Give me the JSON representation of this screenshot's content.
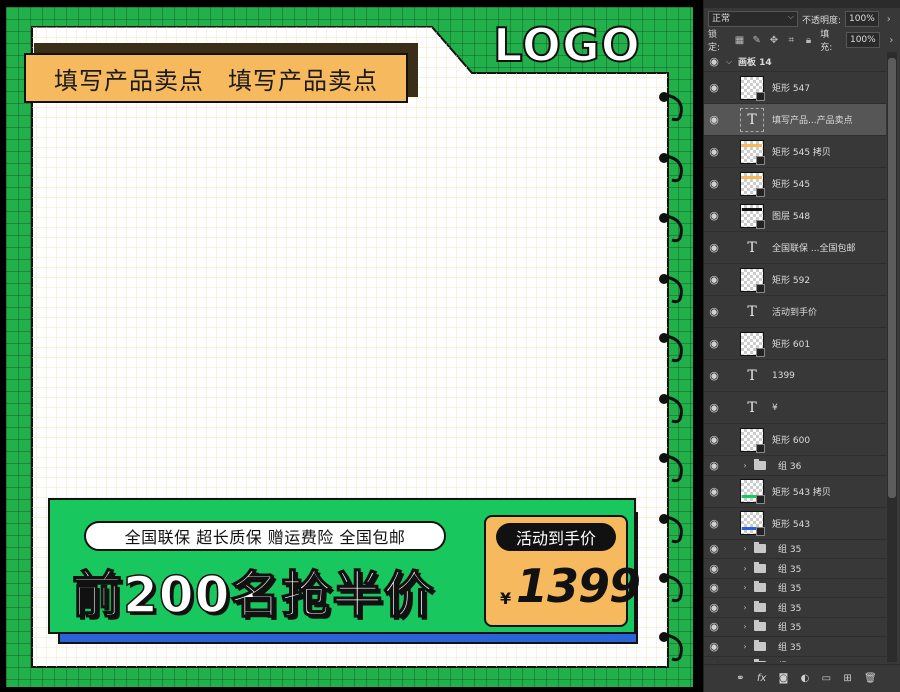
{
  "canvas": {
    "logo_text": "LOGO",
    "selling_points": [
      "填写产品卖点",
      "填写产品卖点"
    ],
    "guarantee_text": "全国联保 超长质保 赠运费险 全国包邮",
    "headline": "前200名抢半价",
    "activity_label": "活动到手价",
    "currency": "¥",
    "price": "1399"
  },
  "layers_panel": {
    "blend_mode": "正常",
    "opacity_label": "不透明度:",
    "opacity_value": "100%",
    "lock_label": "锁定:",
    "fill_label": "填充:",
    "fill_value": "100%",
    "artboard_name": "画板 14",
    "layers": [
      {
        "name": "矩形 547",
        "kind": "shape",
        "strip": ""
      },
      {
        "name": "填写产品...产品卖点",
        "kind": "text",
        "selected": true
      },
      {
        "name": "矩形 545 拷贝",
        "kind": "shape",
        "strip": "#f7b95e"
      },
      {
        "name": "矩形 545",
        "kind": "shape",
        "strip": "#f7b95e"
      },
      {
        "name": "图层 548",
        "kind": "shape",
        "strip": "#111111"
      },
      {
        "name": "全国联保 ...全国包邮",
        "kind": "text"
      },
      {
        "name": "矩形 592",
        "kind": "shape",
        "strip": ""
      },
      {
        "name": "活动到手价",
        "kind": "text"
      },
      {
        "name": "矩形 601",
        "kind": "shape",
        "strip": ""
      },
      {
        "name": "1399",
        "kind": "text"
      },
      {
        "name": "¥",
        "kind": "text"
      },
      {
        "name": "矩形 600",
        "kind": "shape",
        "strip": ""
      },
      {
        "name": "组 36",
        "kind": "group"
      },
      {
        "name": "矩形 543 拷贝",
        "kind": "shape",
        "strip": "#18c85e"
      },
      {
        "name": "矩形 543",
        "kind": "shape",
        "strip": "#2a63d6"
      },
      {
        "name": "组 35",
        "kind": "group"
      },
      {
        "name": "组 35",
        "kind": "group"
      },
      {
        "name": "组 35",
        "kind": "group"
      },
      {
        "name": "组 35",
        "kind": "group"
      },
      {
        "name": "组 35",
        "kind": "group"
      },
      {
        "name": "组 35",
        "kind": "group"
      },
      {
        "name": "组 35",
        "kind": "group"
      }
    ],
    "footer_icons": [
      "link-icon",
      "fx-icon",
      "mask-icon",
      "adjustment-icon",
      "new-group-icon",
      "new-layer-icon",
      "trash-icon"
    ]
  },
  "colors": {
    "artboard_green": "#22b04a",
    "banner_green": "#18c85e",
    "banner_blue": "#2a63d6",
    "accent_orange": "#f7b95e"
  }
}
